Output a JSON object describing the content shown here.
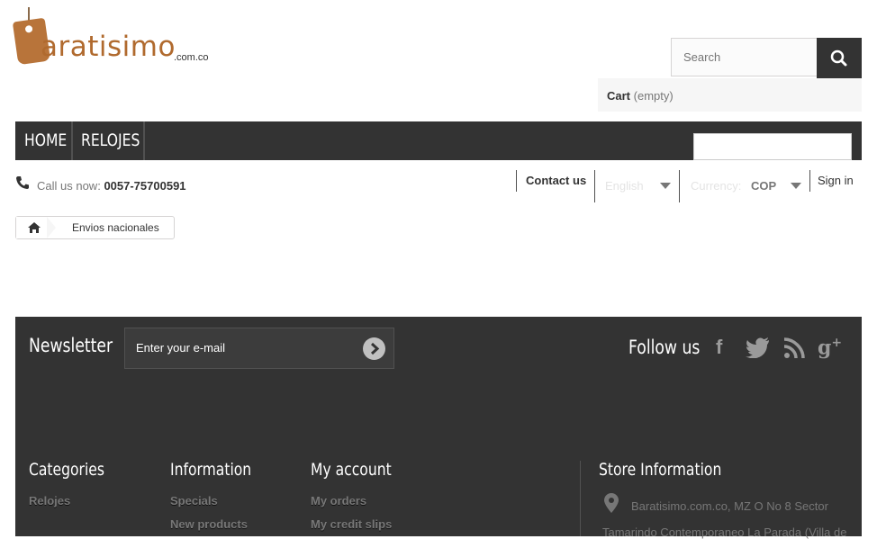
{
  "header": {
    "logo_text": "aratisimo",
    "logo_suffix": ".com.co",
    "search_placeholder": "Search",
    "cart_label": "Cart",
    "cart_state": "(empty)"
  },
  "nav": {
    "items": [
      {
        "label": "HOME"
      },
      {
        "label": "RELOJES"
      }
    ]
  },
  "topbar": {
    "call_label": "Call us now:",
    "phone": "0057-75700591",
    "contact_label": "Contact us",
    "language": "English",
    "currency_label": "Currency:",
    "currency_value": "COP",
    "signin_label": "Sign in"
  },
  "breadcrumb": {
    "current": "Envios nacionales"
  },
  "footer": {
    "newsletter_title": "Newsletter",
    "newsletter_placeholder": "Enter your e-mail",
    "follow_title": "Follow us",
    "social_icons": [
      "facebook-icon",
      "twitter-icon",
      "rss-icon",
      "google-plus-icon"
    ],
    "columns": [
      {
        "title": "Categories",
        "links": [
          "Relojes"
        ]
      },
      {
        "title": "Information",
        "links": [
          "Specials",
          "New products"
        ]
      },
      {
        "title": "My account",
        "links": [
          "My orders",
          "My credit slips"
        ]
      }
    ],
    "store_title": "Store Information",
    "store_address_line1": "Baratisimo.com.co, MZ O No 8 Sector",
    "store_address_line2": "Tamarindo Contemporaneo La Parada (Villa de"
  },
  "colors": {
    "dark": "#333333",
    "logo_orange": "#b06a2e",
    "muted": "#777777"
  }
}
